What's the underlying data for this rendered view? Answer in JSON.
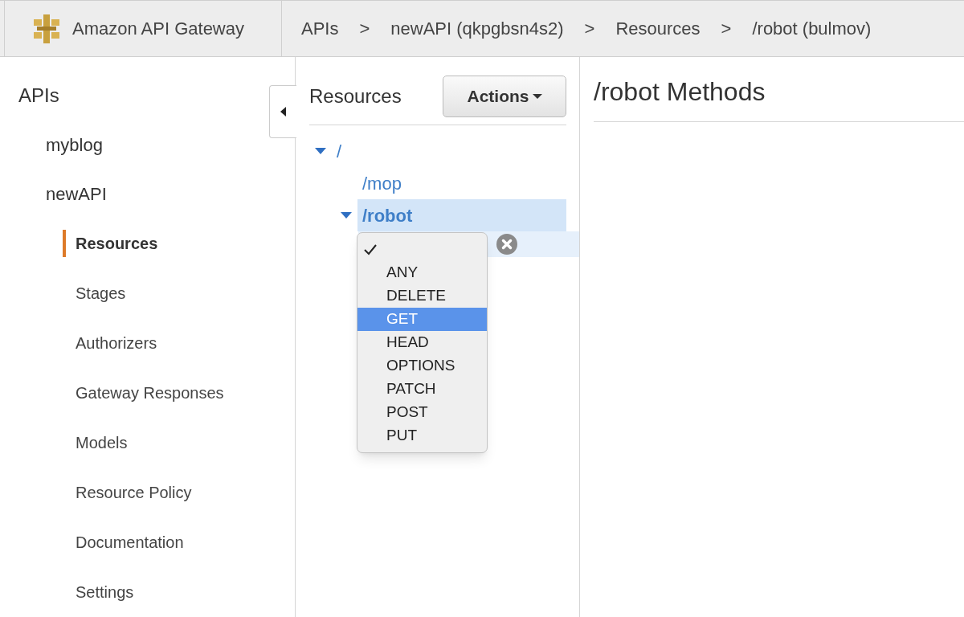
{
  "header": {
    "brand": "Amazon API Gateway",
    "breadcrumbs": [
      "APIs",
      ">",
      "newAPI (qkpgbsn4s2)",
      ">",
      "Resources",
      ">",
      "/robot (bulmov)"
    ]
  },
  "sidebar": {
    "title": "APIs",
    "apis": [
      {
        "label": "myblog"
      },
      {
        "label": "newAPI"
      }
    ],
    "items": [
      {
        "label": "Resources",
        "selected": true
      },
      {
        "label": "Stages",
        "selected": false
      },
      {
        "label": "Authorizers",
        "selected": false
      },
      {
        "label": "Gateway Responses",
        "selected": false
      },
      {
        "label": "Models",
        "selected": false
      },
      {
        "label": "Resource Policy",
        "selected": false
      },
      {
        "label": "Documentation",
        "selected": false
      },
      {
        "label": "Settings",
        "selected": false
      }
    ]
  },
  "resources": {
    "title": "Resources",
    "actions_button": "Actions",
    "tree": [
      {
        "label": "/",
        "expanded": true,
        "selected": false,
        "children": [
          {
            "label": "/mop",
            "selected": false
          },
          {
            "label": "/robot",
            "expanded": true,
            "selected": true
          }
        ]
      }
    ]
  },
  "method_dropdown": {
    "blank_option_checked": true,
    "options": [
      {
        "label": "ANY",
        "selected": false
      },
      {
        "label": "DELETE",
        "selected": false
      },
      {
        "label": "GET",
        "selected": true
      },
      {
        "label": "HEAD",
        "selected": false
      },
      {
        "label": "OPTIONS",
        "selected": false
      },
      {
        "label": "PATCH",
        "selected": false
      },
      {
        "label": "POST",
        "selected": false
      },
      {
        "label": "PUT",
        "selected": false
      }
    ]
  },
  "content": {
    "title": "/robot Methods"
  }
}
